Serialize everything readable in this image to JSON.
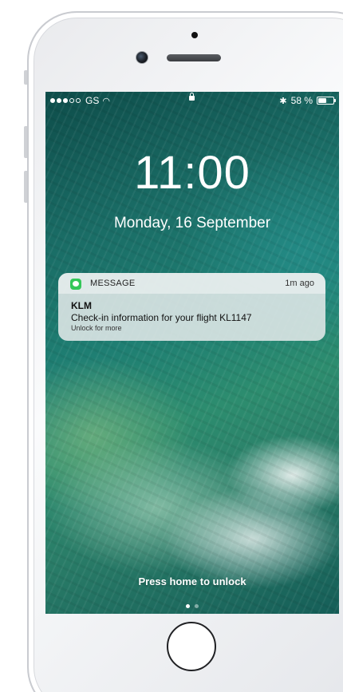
{
  "status_bar": {
    "signal_dots_filled": 3,
    "signal_dots_total": 5,
    "carrier": "GS",
    "wifi_icon": "wifi-icon",
    "lock_icon": "lock-icon",
    "bluetooth_icon": "bluetooth-icon",
    "battery_text": "58 %",
    "battery_level": 0.58
  },
  "lock_screen": {
    "time": "11:00",
    "date": "Monday, 16 September",
    "press_home_text": "Press home to unlock"
  },
  "notification": {
    "app_name": "MESSAGE",
    "app_icon": "messages-icon",
    "app_icon_color": "#34c759",
    "time_ago": "1m ago",
    "sender": "KLM",
    "message": "Check-in information for your flight KL1147",
    "hint": "Unlock for more"
  }
}
